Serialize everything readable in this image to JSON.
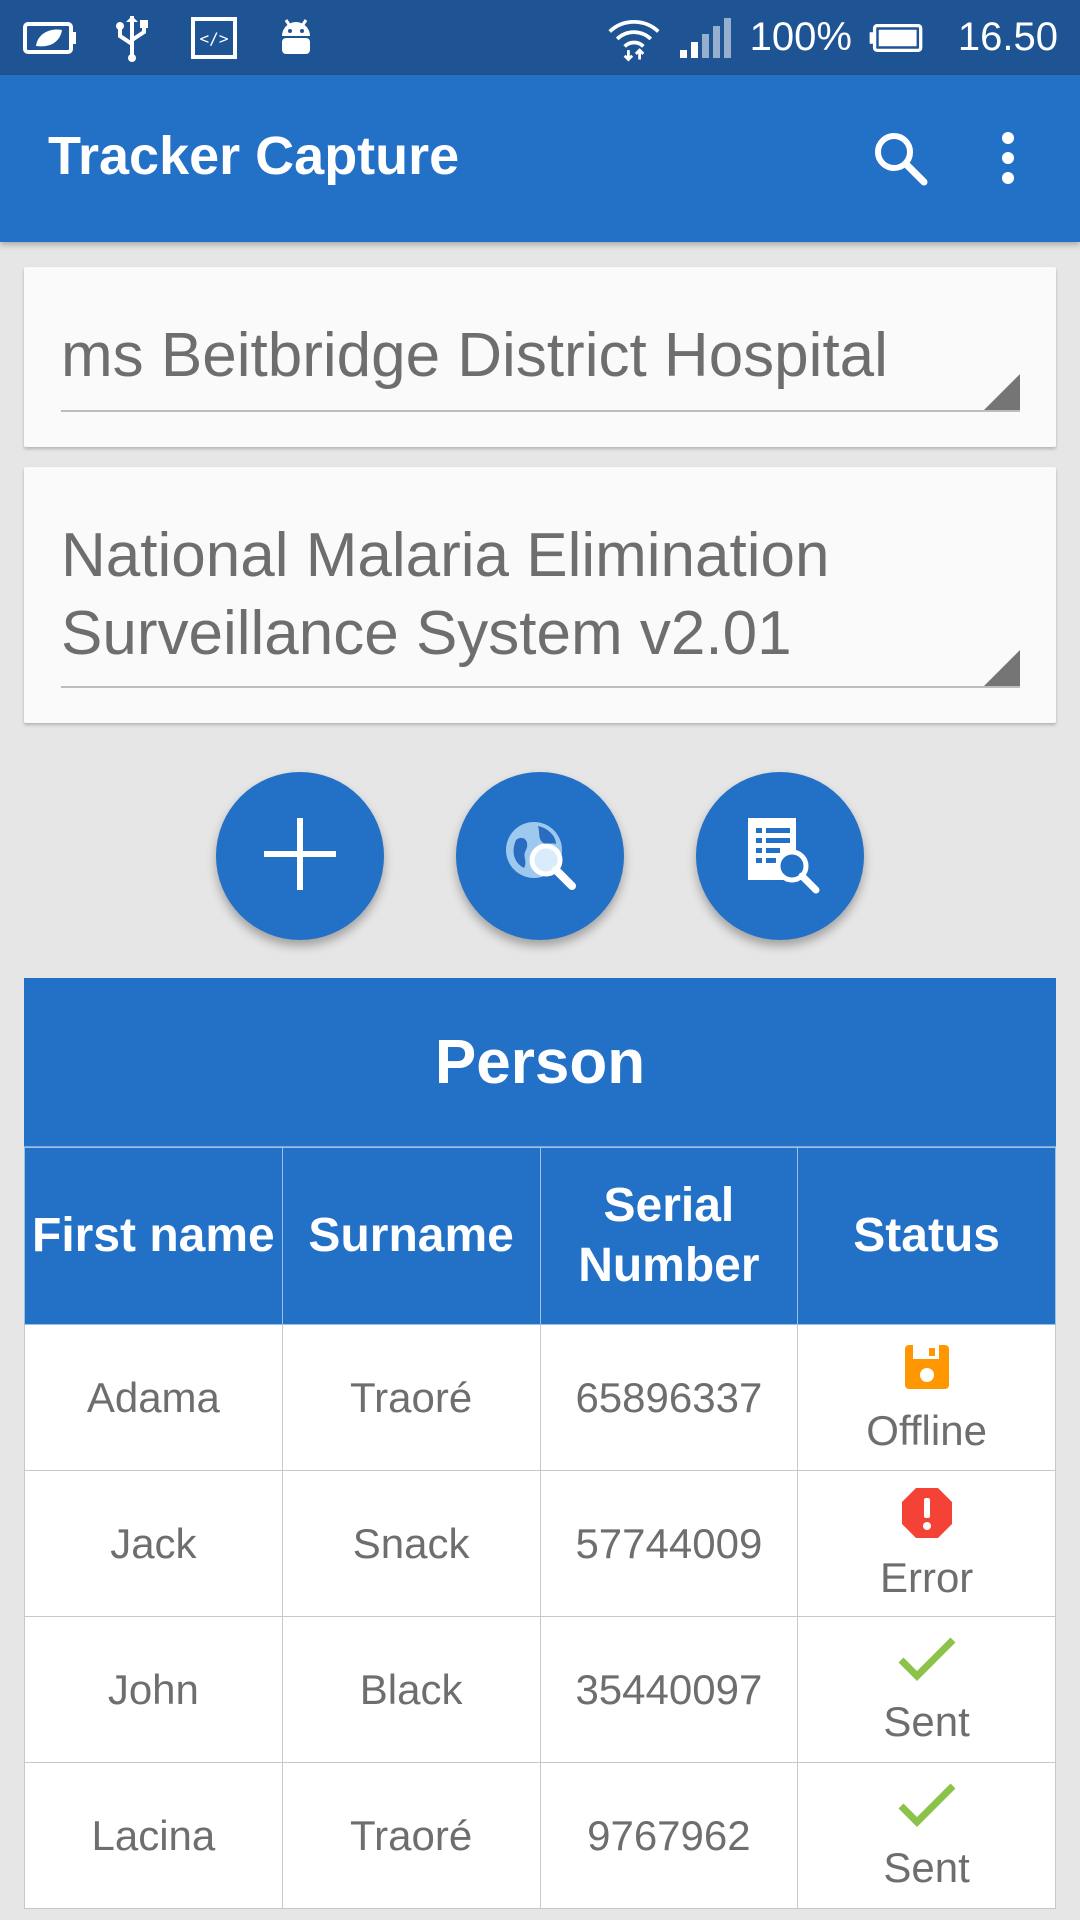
{
  "status_bar": {
    "battery": "100%",
    "time": "16.50",
    "left_icons": [
      "leaf-battery-icon",
      "usb-icon",
      "code-icon",
      "android-icon"
    ],
    "right_icons": [
      "wifi-icon",
      "signal-icon",
      "battery-icon"
    ]
  },
  "app_bar": {
    "title": "Tracker Capture",
    "actions": [
      "search-icon",
      "more-vert-icon"
    ],
    "color": "#2370c7"
  },
  "org_unit_spinner": {
    "value": "ms Beitbridge District Hospital"
  },
  "program_spinner": {
    "value": "National Malaria Elimination\nSurveillance System v2.01"
  },
  "fab_buttons": [
    {
      "icon": "add-icon"
    },
    {
      "icon": "online-search-icon"
    },
    {
      "icon": "local-search-icon"
    }
  ],
  "table": {
    "title": "Person",
    "columns": [
      "First name",
      "Surname",
      "Serial Number",
      "Status"
    ],
    "rows": [
      {
        "first_name": "Adama",
        "surname": "Traoré",
        "serial": "65896337",
        "status": "Offline",
        "status_icon": "save-icon",
        "status_color": "#ff9800"
      },
      {
        "first_name": "Jack",
        "surname": "Snack",
        "serial": "57744009",
        "status": "Error",
        "status_icon": "error-icon",
        "status_color": "#f44336"
      },
      {
        "first_name": "John",
        "surname": "Black",
        "serial": "35440097",
        "status": "Sent",
        "status_icon": "check-icon",
        "status_color": "#8bc34a"
      },
      {
        "first_name": "Lacina",
        "surname": "Traoré",
        "serial": "9767962",
        "status": "Sent",
        "status_icon": "check-icon",
        "status_color": "#8bc34a"
      }
    ]
  }
}
